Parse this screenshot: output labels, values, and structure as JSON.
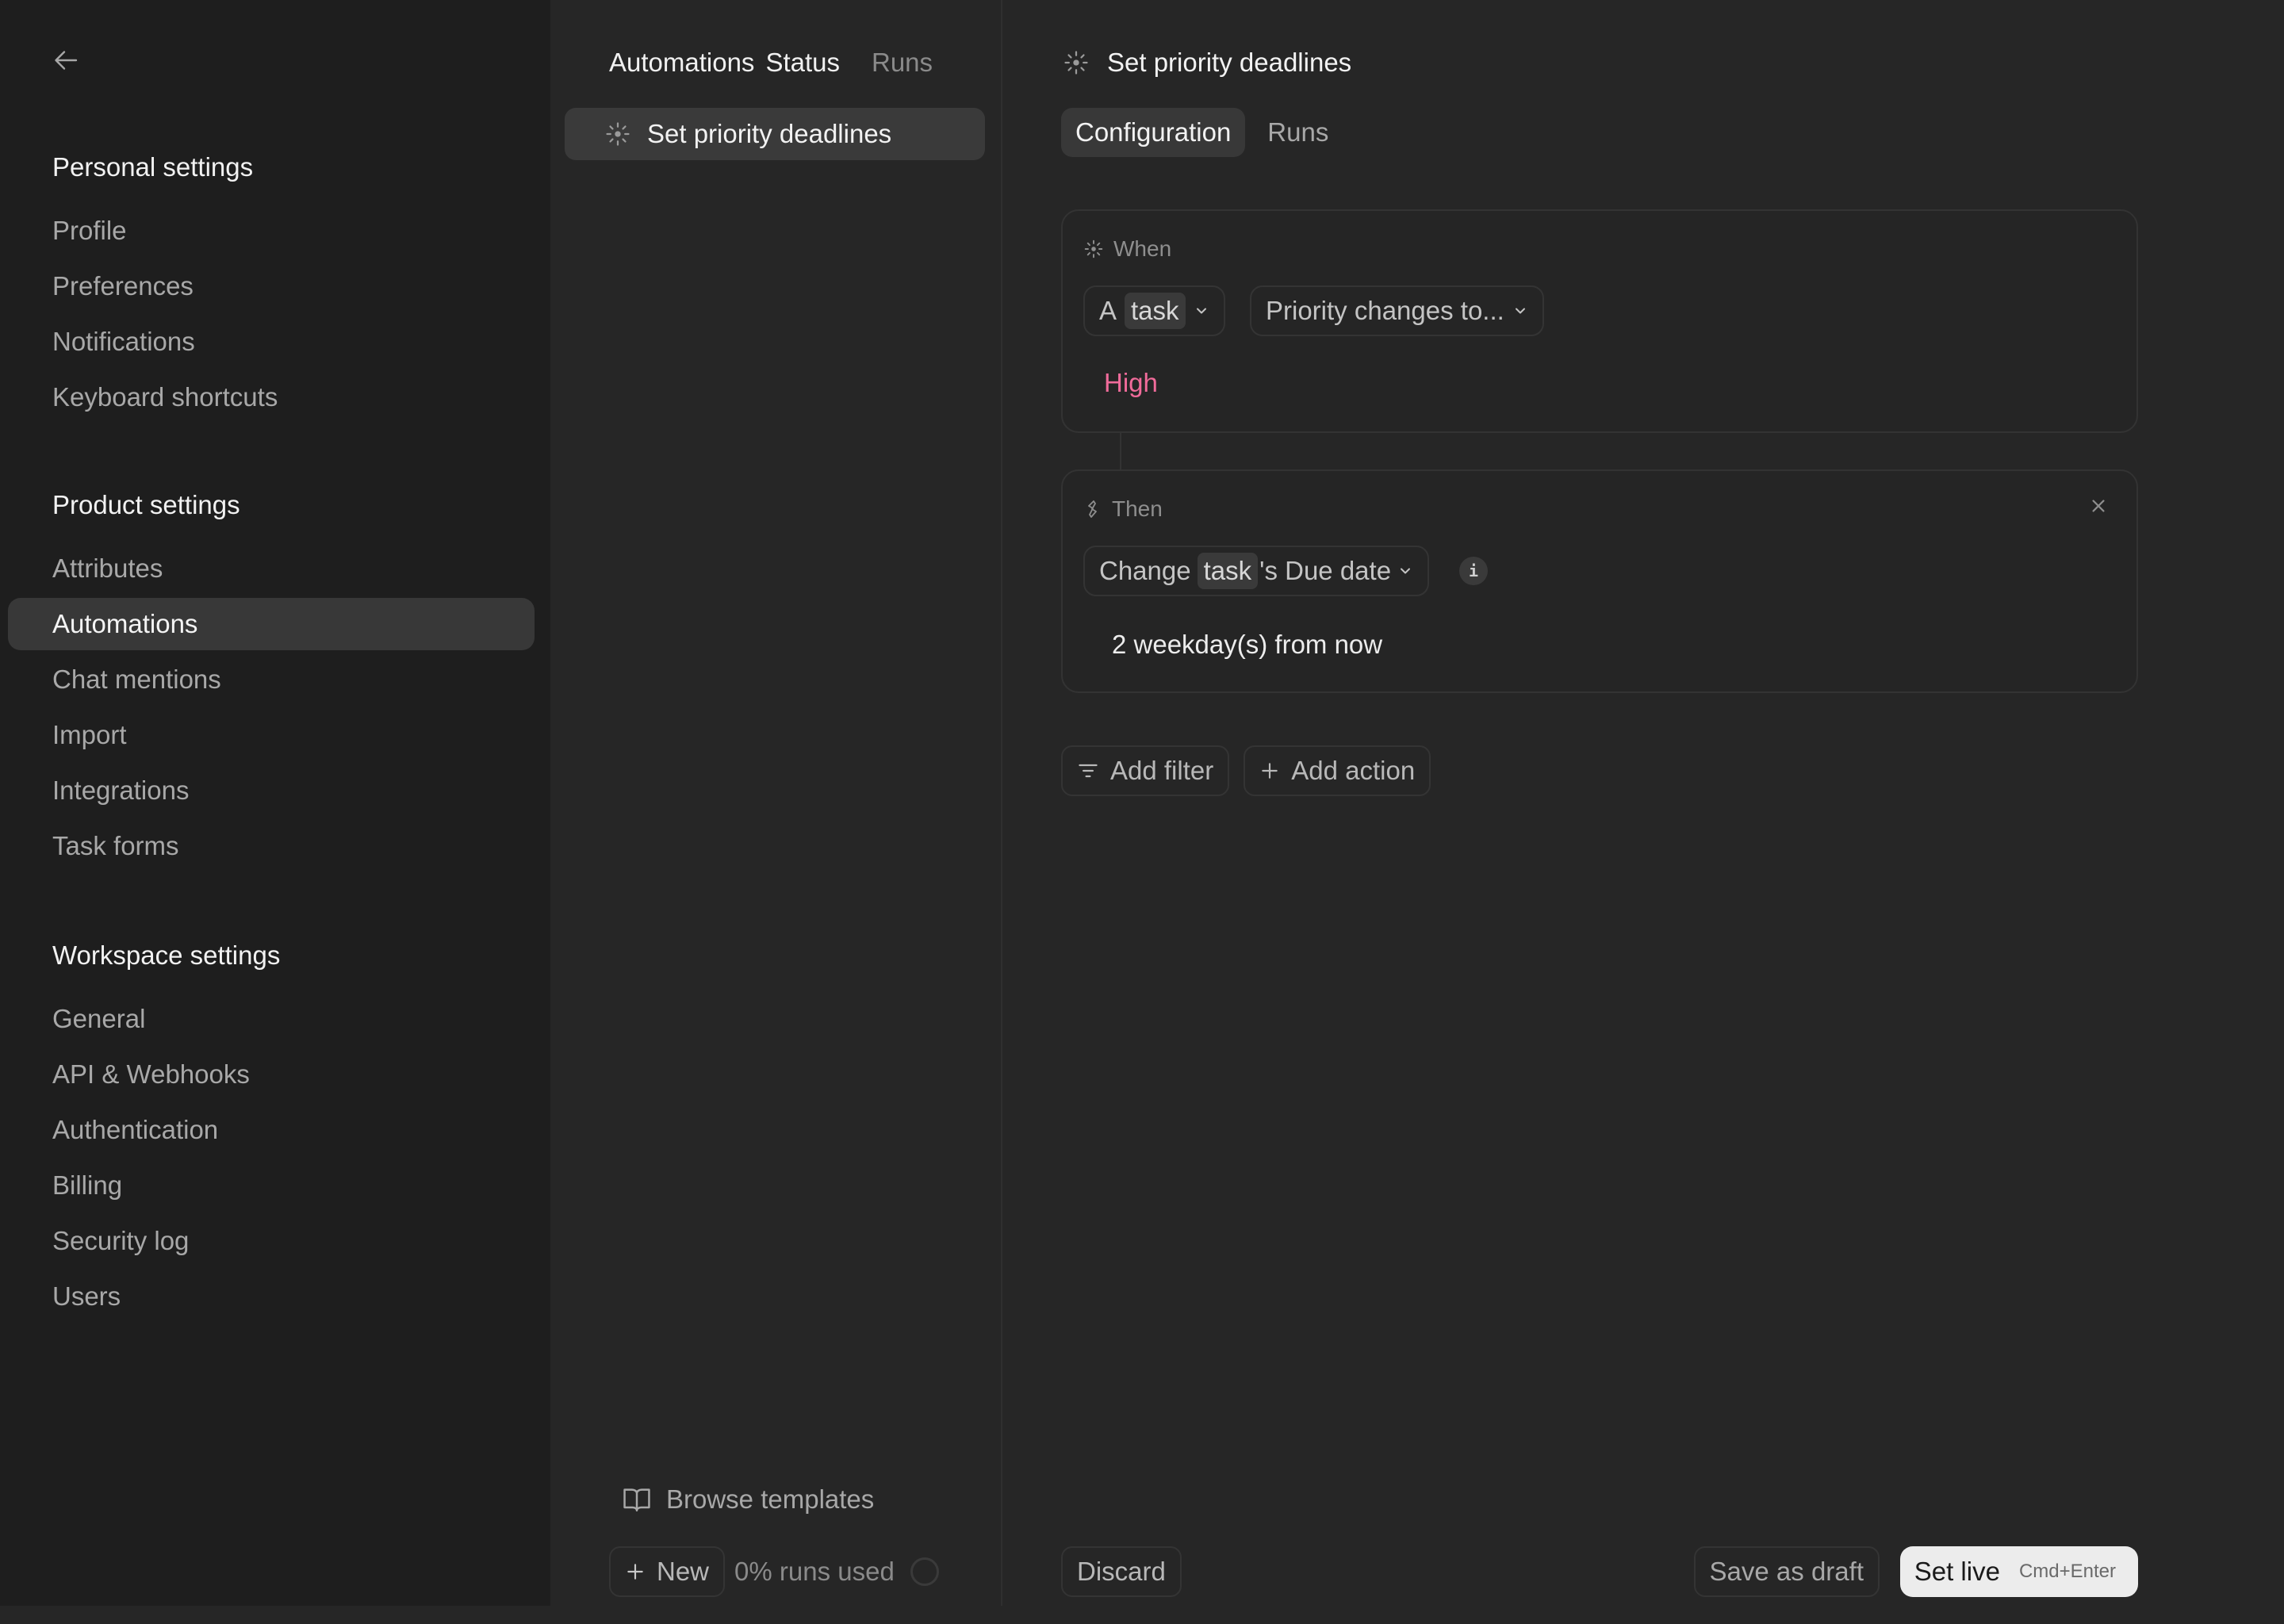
{
  "sidebar": {
    "back_icon": "arrow-left-icon",
    "groups": [
      {
        "title": "Personal settings",
        "items": [
          {
            "label": "Profile",
            "active": false
          },
          {
            "label": "Preferences",
            "active": false
          },
          {
            "label": "Notifications",
            "active": false
          },
          {
            "label": "Keyboard shortcuts",
            "active": false
          }
        ]
      },
      {
        "title": "Product settings",
        "items": [
          {
            "label": "Attributes",
            "active": false
          },
          {
            "label": "Automations",
            "active": true
          },
          {
            "label": "Chat mentions",
            "active": false
          },
          {
            "label": "Import",
            "active": false
          },
          {
            "label": "Integrations",
            "active": false
          },
          {
            "label": "Task forms",
            "active": false
          }
        ]
      },
      {
        "title": "Workspace settings",
        "items": [
          {
            "label": "General",
            "active": false
          },
          {
            "label": "API & Webhooks",
            "active": false
          },
          {
            "label": "Authentication",
            "active": false
          },
          {
            "label": "Billing",
            "active": false
          },
          {
            "label": "Security log",
            "active": false
          },
          {
            "label": "Users",
            "active": false
          }
        ]
      }
    ]
  },
  "automations_list": {
    "header_title": "Automations",
    "header_status": "Status",
    "header_runs": "Runs",
    "items": [
      {
        "label": "Set priority deadlines",
        "icon": "sun-icon",
        "selected": true
      }
    ],
    "browse_templates": "Browse templates",
    "new_button": "New",
    "runs_used": "0% runs used",
    "runs_used_fraction": 0
  },
  "editor": {
    "title": "Set priority deadlines",
    "tabs": [
      {
        "label": "Configuration",
        "active": true
      },
      {
        "label": "Runs",
        "active": false
      }
    ],
    "when": {
      "label": "When",
      "subject_prefix": "A",
      "subject_chip": "task",
      "trigger": "Priority changes to...",
      "value": "High",
      "value_color": "#f06b9a"
    },
    "then": {
      "label": "Then",
      "action_prefix": "Change",
      "action_chip": "task",
      "action_suffix": "'s Due date",
      "info_glyph": "i",
      "value": "2 weekday(s) from now"
    },
    "add_filter": "Add filter",
    "add_action": "Add action",
    "discard": "Discard",
    "save_draft": "Save as draft",
    "set_live": "Set live",
    "set_live_shortcut": "Cmd+Enter"
  }
}
